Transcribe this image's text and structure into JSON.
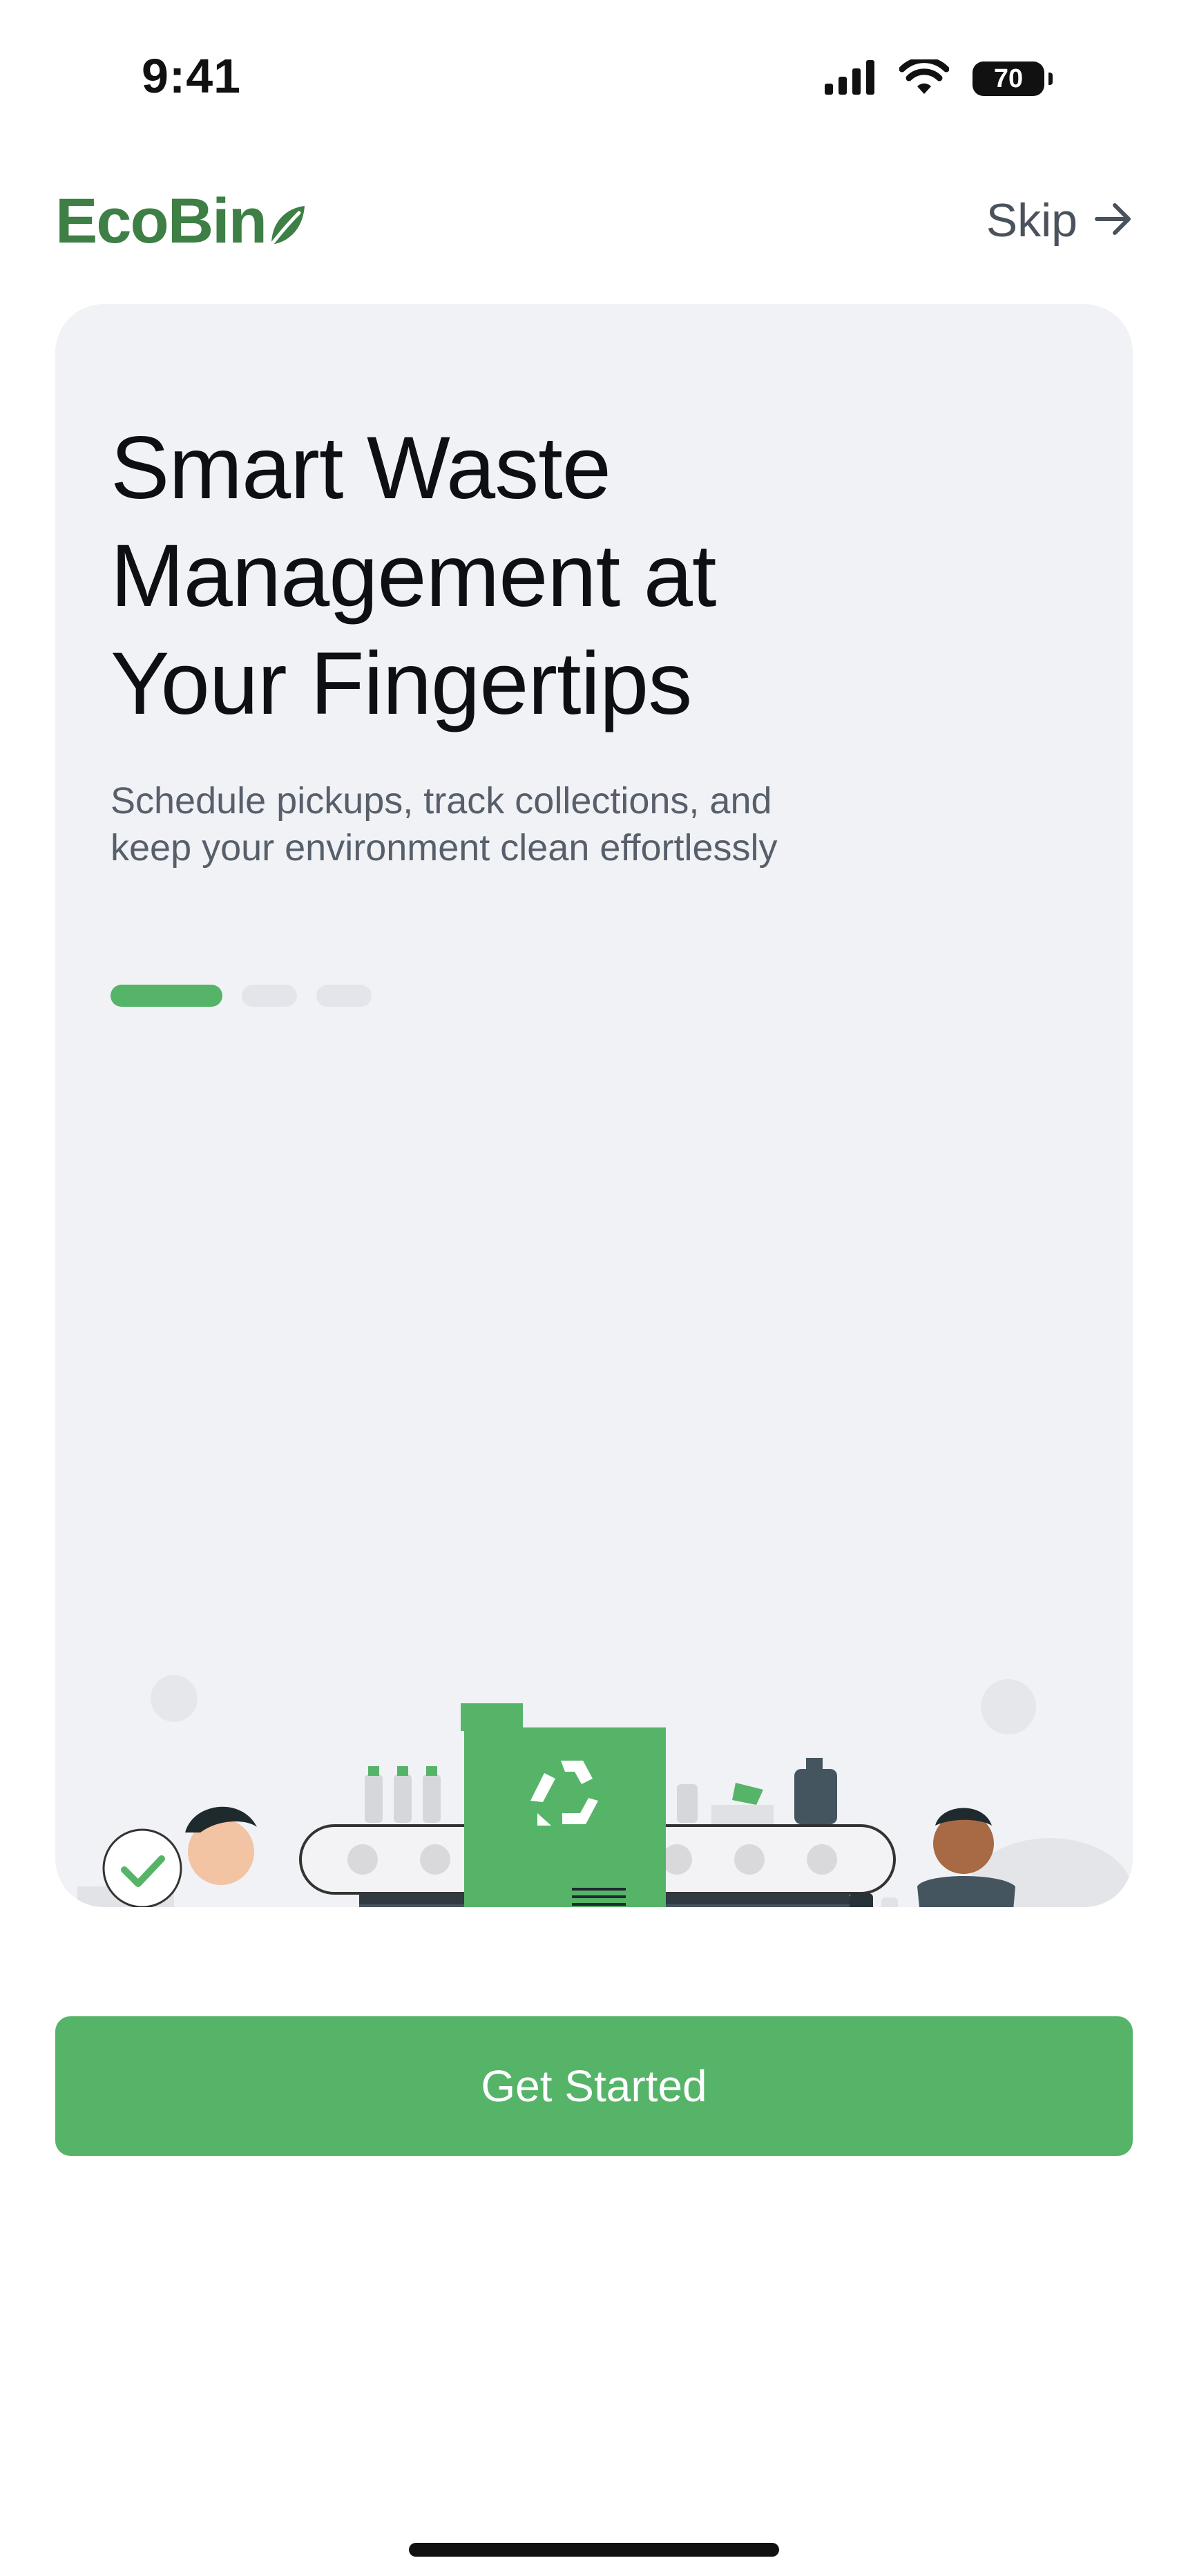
{
  "status_bar": {
    "time": "9:41",
    "battery_level": "70",
    "icons": [
      "signal-icon",
      "wifi-icon",
      "battery-icon"
    ]
  },
  "header": {
    "logo_text": "EcoBin",
    "logo_icon": "leaf-icon",
    "skip_label": "Skip",
    "skip_icon": "arrow-right-icon"
  },
  "onboarding": {
    "title": "Smart Waste Management at Your Fingertips",
    "subtitle": "Schedule pickups, track collections, and keep your environment clean effortlessly",
    "pager": {
      "total": 3,
      "current": 1
    },
    "illustration": "recycling-workers-illustration"
  },
  "cta": {
    "label": "Get Started"
  },
  "colors": {
    "brand_green": "#56B468",
    "logo_green": "#3D7F45",
    "card_background": "#F1F2F6",
    "dark_slate": "#455560"
  }
}
